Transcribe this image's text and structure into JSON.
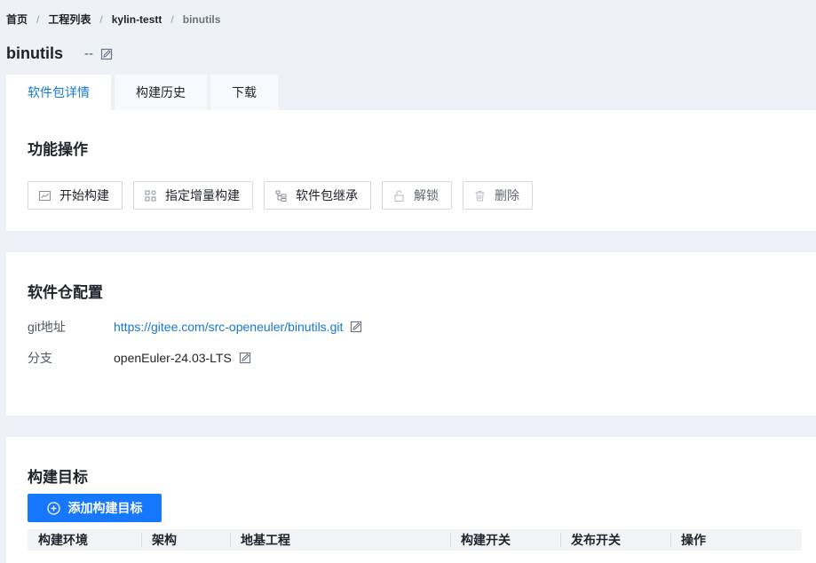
{
  "breadcrumb": {
    "items": [
      "首页",
      "工程列表",
      "kylin-testt",
      "binutils"
    ],
    "separator": "/"
  },
  "header": {
    "name": "binutils",
    "description": "--"
  },
  "tabs": [
    {
      "label": "软件包详情",
      "active": true
    },
    {
      "label": "构建历史",
      "active": false
    },
    {
      "label": "下载",
      "active": false
    }
  ],
  "operations": {
    "title": "功能操作",
    "buttons": [
      {
        "label": "开始构建",
        "icon": "chart-icon"
      },
      {
        "label": "指定增量构建",
        "icon": "grid-icon"
      },
      {
        "label": "软件包继承",
        "icon": "tree-icon"
      },
      {
        "label": "解锁",
        "icon": "unlock-icon"
      },
      {
        "label": "删除",
        "icon": "trash-icon"
      }
    ]
  },
  "repo": {
    "title": "软件仓配置",
    "git_label": "git地址",
    "git_value": "https://gitee.com/src-openeuler/binutils.git",
    "branch_label": "分支",
    "branch_value": "openEuler-24.03-LTS"
  },
  "targets": {
    "title": "构建目标",
    "add_label": "添加构建目标",
    "columns": [
      "构建环境",
      "架构",
      "地基工程",
      "构建开关",
      "发布开关",
      "操作"
    ]
  },
  "colors": {
    "accent": "#1677ff",
    "link": "#1677d2",
    "background": "#eef2f7"
  }
}
